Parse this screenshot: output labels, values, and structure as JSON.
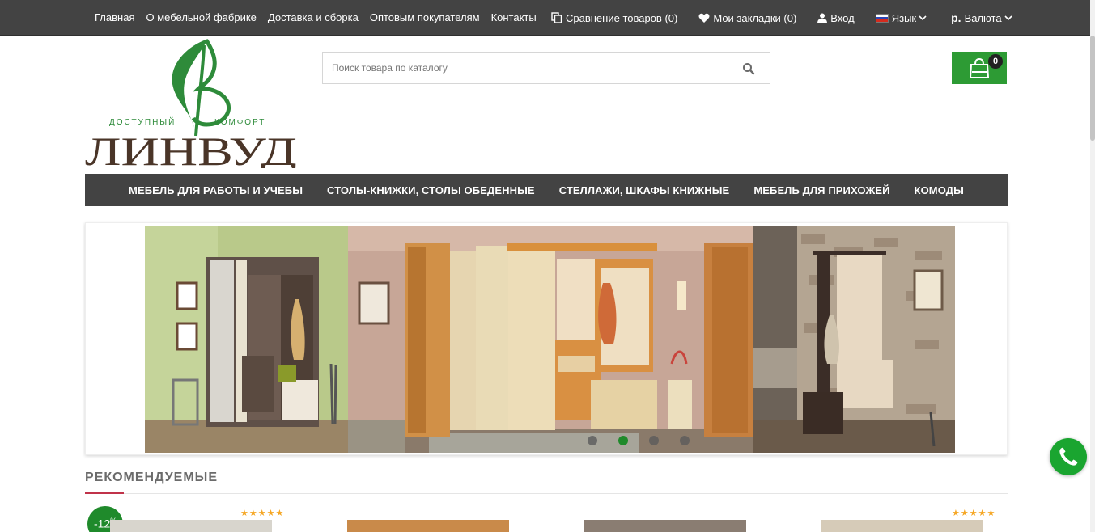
{
  "topnav": {
    "links": [
      "Главная",
      "О мебельной фабрике",
      "Доставка и сборка",
      "Оптовым покупателям",
      "Контакты"
    ],
    "compare": "Сравнение товаров (0)",
    "wishlist": "Мои закладки (0)",
    "login": "Вход",
    "language": "Язык",
    "currency_symbol": "р.",
    "currency": "Валюта"
  },
  "logo": {
    "tagline_left": "ДОСТУПНЫЙ",
    "tagline_right": "КОМФОРТ",
    "brand": "ЛИНВУД"
  },
  "search": {
    "placeholder": "Поиск товара по каталогу"
  },
  "cart": {
    "count": "0"
  },
  "categories": [
    "МЕБЕЛЬ ДЛЯ РАБОТЫ И УЧЕБЫ",
    "СТОЛЫ-КНИЖКИ, СТОЛЫ ОБЕДЕННЫЕ",
    "СТЕЛЛАЖИ, ШКАФЫ КНИЖНЫЕ",
    "МЕБЕЛЬ ДЛЯ ПРИХОЖЕЙ",
    "КОМОДЫ"
  ],
  "slider": {
    "slide_count": 4,
    "active_slide": 2
  },
  "recommended": {
    "title": "РЕКОМЕНДУЕМЫЕ",
    "sale_badge": "-12",
    "sale_suffix": "%",
    "stars_1": "★★★★★",
    "stars_4": "★★★★★"
  },
  "colors": {
    "topbar": "#434343",
    "accent_green": "#2d9b34",
    "active_dot": "#1f8a2b",
    "rec_accent": "#c0334a"
  }
}
